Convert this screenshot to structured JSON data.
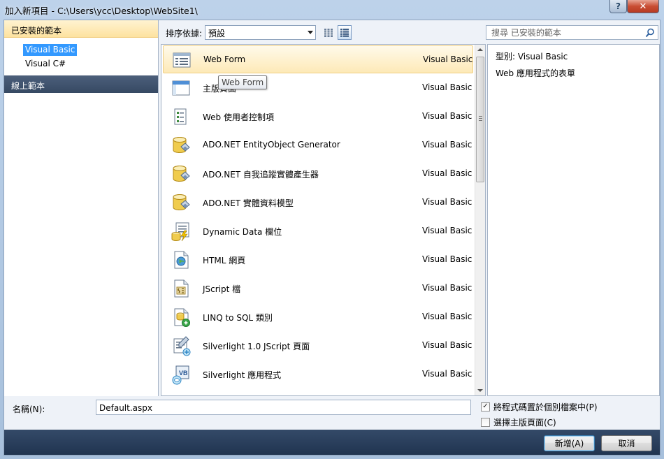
{
  "window": {
    "title": "加入新項目 - C:\\Users\\ycc\\Desktop\\WebSite1\\",
    "help_label": "?",
    "close_label": "✕"
  },
  "left_pane": {
    "installed_header": "已安裝的範本",
    "languages": [
      "Visual Basic",
      "Visual C#"
    ],
    "online_header": "線上範本"
  },
  "toolbar": {
    "sort_label": "排序依據:",
    "sort_value": "預設",
    "search_placeholder": "搜尋 已安裝的範本"
  },
  "templates": [
    {
      "name": "Web Form",
      "lang": "Visual Basic",
      "icon": "webform-icon"
    },
    {
      "name": "主版頁面",
      "lang": "Visual Basic",
      "icon": "masterpage-icon"
    },
    {
      "name": "Web 使用者控制項",
      "lang": "Visual Basic",
      "icon": "usercontrol-icon"
    },
    {
      "name": "ADO.NET EntityObject Generator",
      "lang": "Visual Basic",
      "icon": "database-icon"
    },
    {
      "name": "ADO.NET 自我追蹤實體產生器",
      "lang": "Visual Basic",
      "icon": "database-icon"
    },
    {
      "name": "ADO.NET 實體資料模型",
      "lang": "Visual Basic",
      "icon": "database-icon"
    },
    {
      "name": "Dynamic Data 欄位",
      "lang": "Visual Basic",
      "icon": "dynamicdata-icon"
    },
    {
      "name": "HTML 網頁",
      "lang": "Visual Basic",
      "icon": "html-icon"
    },
    {
      "name": "JScript 檔",
      "lang": "Visual Basic",
      "icon": "jscript-icon"
    },
    {
      "name": "LINQ to SQL 類別",
      "lang": "Visual Basic",
      "icon": "linq-icon"
    },
    {
      "name": "Silverlight 1.0 JScript 頁面",
      "lang": "Visual Basic",
      "icon": "silverlight-icon"
    },
    {
      "name": "Silverlight 應用程式",
      "lang": "Visual Basic",
      "icon": "silverlight-vb-icon"
    }
  ],
  "tooltip": "Web Form",
  "info": {
    "type_line": "型別:  Visual Basic",
    "description": "Web 應用程式的表單"
  },
  "bottom": {
    "name_label": "名稱(N):",
    "name_value": "Default.aspx",
    "separate_code_label": "將程式碼置於個別檔案中(P)",
    "separate_code_checked": true,
    "master_page_label": "選擇主版頁面(C)",
    "master_page_checked": false
  },
  "buttons": {
    "add_label": "新增(A)",
    "cancel_label": "取消"
  }
}
